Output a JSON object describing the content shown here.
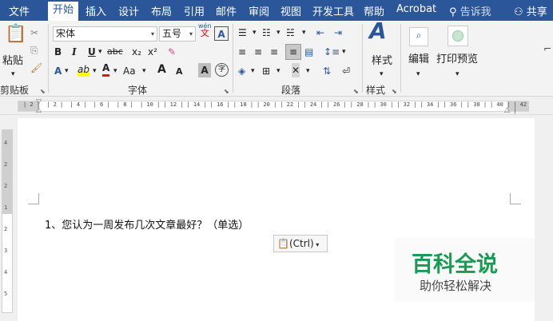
{
  "menu": {
    "items": [
      "文件",
      "开始",
      "插入",
      "设计",
      "布局",
      "引用",
      "邮件",
      "审阅",
      "视图",
      "开发工具",
      "帮助",
      "Acrobat"
    ],
    "active": "开始",
    "tell_me": "告诉我",
    "share": "共享"
  },
  "ribbon": {
    "clipboard": {
      "paste": "粘贴",
      "label": "剪贴板"
    },
    "font": {
      "name": "宋体",
      "size": "五号",
      "phonetic_top": "wén",
      "phonetic_bottom": "文",
      "bold": "B",
      "italic": "I",
      "underline": "U",
      "strike": "abc",
      "sub": "x₂",
      "sup": "x²",
      "highlight": "ab",
      "color_a": "A",
      "aa": "Aa",
      "grow": "A",
      "shrink": "A",
      "shade": "A",
      "enclose": "字",
      "label": "字体"
    },
    "paragraph": {
      "label": "段落"
    },
    "styles": {
      "button": "样式",
      "label": "样式"
    },
    "editing": {
      "button": "编辑"
    },
    "print_preview": {
      "button": "打印预览"
    }
  },
  "ruler": {
    "numbers": [
      "2",
      "2",
      "4",
      "6",
      "8",
      "10",
      "12",
      "14",
      "16",
      "18",
      "20",
      "22",
      "24",
      "26",
      "28",
      "30",
      "32",
      "34",
      "36",
      "38",
      "40",
      "42"
    ],
    "vnumbers": [
      "4",
      "2",
      "2",
      "1",
      "2",
      "3",
      "4",
      "5"
    ]
  },
  "document": {
    "text": "1、您认为一周发布几次文章最好？（单选）",
    "paste_options": "(Ctrl)"
  },
  "watermark": {
    "title": "百科全说",
    "subtitle": "助你轻松解决"
  },
  "colors": {
    "accent": "#2b579a",
    "watermark_green": "#1a9a52",
    "font_color_red": "#d81e06",
    "highlight_yellow": "#ffff00"
  }
}
